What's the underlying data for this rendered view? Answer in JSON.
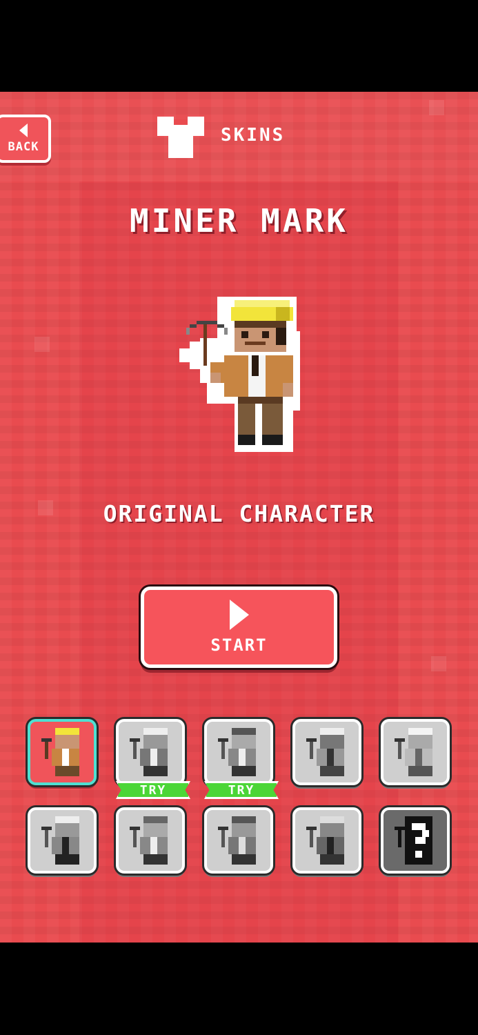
{
  "header": {
    "back_label": "BACK",
    "title": "SKINS"
  },
  "character": {
    "name": "MINER MARK",
    "description": "ORIGINAL CHARACTER"
  },
  "start_button": {
    "label": "START"
  },
  "skins": [
    {
      "state": "selected",
      "badge": ""
    },
    {
      "state": "locked",
      "badge": "TRY"
    },
    {
      "state": "locked",
      "badge": "TRY"
    },
    {
      "state": "locked",
      "badge": ""
    },
    {
      "state": "locked",
      "badge": ""
    },
    {
      "state": "locked",
      "badge": ""
    },
    {
      "state": "locked",
      "badge": ""
    },
    {
      "state": "locked",
      "badge": ""
    },
    {
      "state": "locked",
      "badge": ""
    },
    {
      "state": "mystery",
      "badge": ""
    }
  ],
  "colors": {
    "background": "#e94b4f",
    "button": "#f6545b",
    "selected_border": "#4fe0d2",
    "try_badge": "#4bd637",
    "hat": "#f2e43a",
    "jacket": "#c88542"
  },
  "icons": [
    "back-arrow-icon",
    "shirt-icon",
    "play-icon",
    "pickaxe-icon"
  ]
}
